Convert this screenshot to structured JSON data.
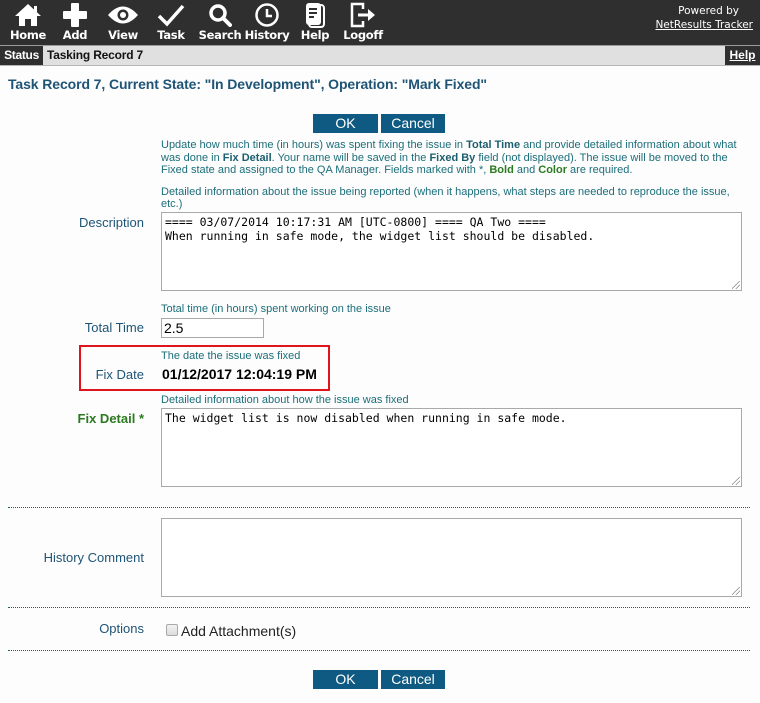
{
  "nav": {
    "items": [
      {
        "label": "Home",
        "icon": "home-icon"
      },
      {
        "label": "Add",
        "icon": "plus-icon"
      },
      {
        "label": "View",
        "icon": "eye-icon"
      },
      {
        "label": "Task",
        "icon": "checkmark-icon"
      },
      {
        "label": "Search",
        "icon": "magnifier-icon"
      },
      {
        "label": "History",
        "icon": "clock-icon"
      },
      {
        "label": "Help",
        "icon": "document-icon"
      },
      {
        "label": "Logoff",
        "icon": "logoff-icon"
      }
    ],
    "powered_by": "Powered by",
    "brand_link": "NetResults Tracker"
  },
  "statusbar": {
    "tag": "Status",
    "text": "Tasking Record 7",
    "help": "Help"
  },
  "page": {
    "title": "Task Record 7, Current State: \"In Development\", Operation: \"Mark Fixed\"",
    "ok_label": "OK",
    "cancel_label": "Cancel"
  },
  "intro": {
    "part1": "Update how much time (in hours) was spent fixing the issue in ",
    "b1": "Total Time",
    "part2": " and provide detailed information about what was done in ",
    "b2": "Fix Detail",
    "part3": ". Your name will be saved in the ",
    "b3": "Fixed By",
    "part4": " field (not displayed). The issue will be moved to the Fixed state and assigned to the QA Manager. Fields marked with *, ",
    "g1": "Bold",
    "part5": " and ",
    "g2": "Color",
    "part6": " are required."
  },
  "fields": {
    "description": {
      "label": "Description",
      "hint": "Detailed information about the issue being reported (when it happens, what steps are needed to reproduce the issue, etc.)",
      "value": "==== 03/07/2014 10:17:31 AM [UTC-0800] ==== QA Two ====\nWhen running in safe mode, the widget list should be disabled."
    },
    "total_time": {
      "label": "Total Time",
      "hint": "Total time (in hours) spent working on the issue",
      "value": "2.5"
    },
    "fix_date": {
      "label": "Fix Date",
      "hint": "The date the issue was fixed",
      "value": "01/12/2017 12:04:19 PM"
    },
    "fix_detail": {
      "label": "Fix Detail *",
      "hint": "Detailed information about how the issue was fixed",
      "value": "The widget list is now disabled when running in safe mode."
    },
    "history_comment": {
      "label": "History Comment",
      "value": ""
    },
    "options": {
      "label": "Options",
      "checkbox_label": "Add Attachment(s)",
      "checked": false
    }
  },
  "colors": {
    "topbar": "#2f2f2f",
    "button": "#0e5a82",
    "title": "#1e5476",
    "hint": "#1b6e7a",
    "required": "#2b7a20",
    "highlight": "#e0141e"
  }
}
